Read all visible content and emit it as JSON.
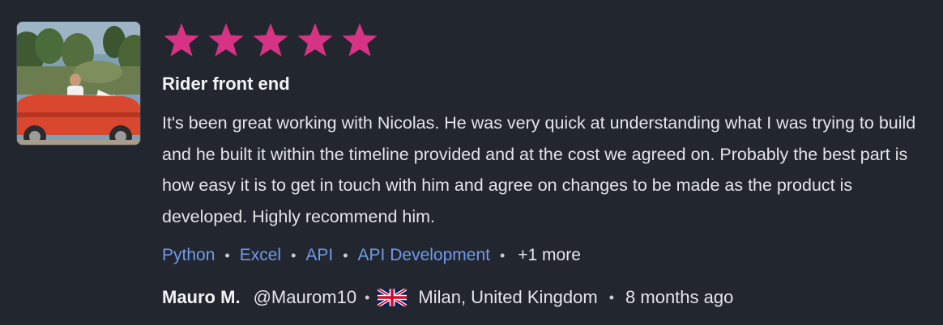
{
  "review": {
    "rating": 5,
    "rating_max": 5,
    "star_color": "#d63384",
    "title": "Rider front end",
    "body": "It's been great working with Nicolas. He was very quick at understanding what I was trying to build and he built it within the timeline provided and at the cost we agreed on. Probably the best part is how easy it is to get in touch with him and agree on changes to be made as the product is developed. Highly recommend him.",
    "skills": [
      "Python",
      "Excel",
      "API",
      "API Development"
    ],
    "more_label": "+1 more",
    "skill_color": "#6f9bea"
  },
  "reviewer": {
    "name": "Mauro M.",
    "handle": "@Maurom10",
    "country_flag_icon": "uk-flag-icon",
    "location": "Milan, United Kingdom",
    "time_ago": "8 months ago"
  }
}
